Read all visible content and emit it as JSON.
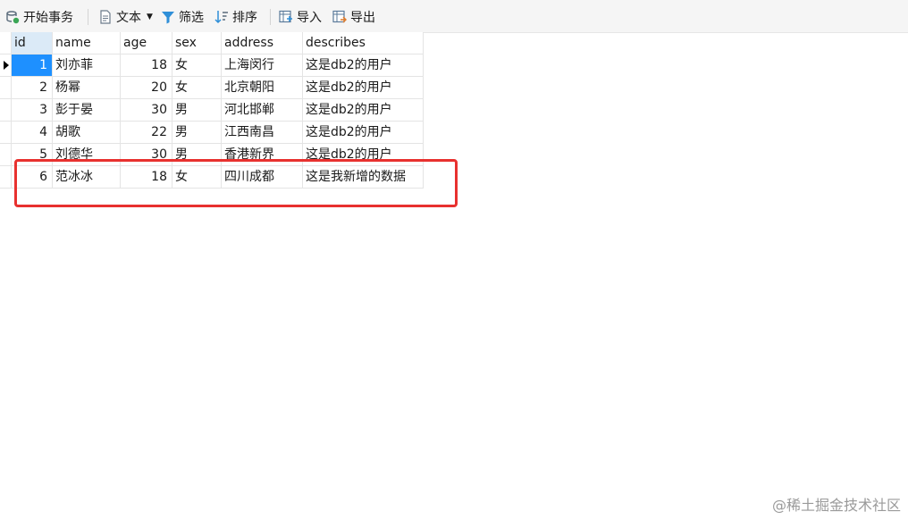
{
  "toolbar": {
    "begin_transaction": "开始事务",
    "text": "文本",
    "filter": "筛选",
    "sort": "排序",
    "import": "导入",
    "export": "导出"
  },
  "table": {
    "columns": [
      "id",
      "name",
      "age",
      "sex",
      "address",
      "describes"
    ],
    "rows": [
      [
        "1",
        "刘亦菲",
        "18",
        "女",
        "上海闵行",
        "这是db2的用户"
      ],
      [
        "2",
        "杨幂",
        "20",
        "女",
        "北京朝阳",
        "这是db2的用户"
      ],
      [
        "3",
        "彭于晏",
        "30",
        "男",
        "河北邯郸",
        "这是db2的用户"
      ],
      [
        "4",
        "胡歌",
        "22",
        "男",
        "江西南昌",
        "这是db2的用户"
      ],
      [
        "5",
        "刘德华",
        "30",
        "男",
        "香港新界",
        "这是db2的用户"
      ],
      [
        "6",
        "范冰冰",
        "18",
        "女",
        "四川成都",
        "这是我新增的数据"
      ]
    ]
  },
  "watermark": "@稀土掘金技术社区",
  "colors": {
    "highlight": "#e8312f",
    "selection": "#1e90ff"
  }
}
